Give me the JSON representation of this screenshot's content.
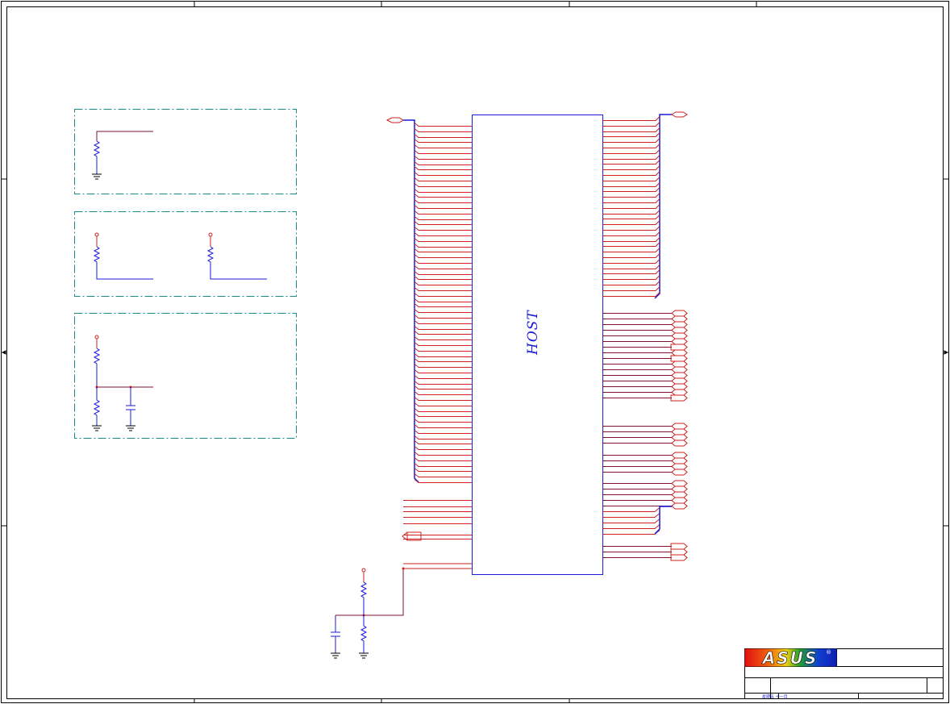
{
  "host_label": "HOST",
  "logo_text": "ASUS",
  "registered_mark": "®",
  "title_block_date": "星期五 十一月",
  "colors": {
    "wire": "#cf2020",
    "net": "#7a1230",
    "bus": "#1b1bd8",
    "box": "#1b1bd8",
    "frame": "#000000",
    "dash_box": "#1b8a8a"
  }
}
